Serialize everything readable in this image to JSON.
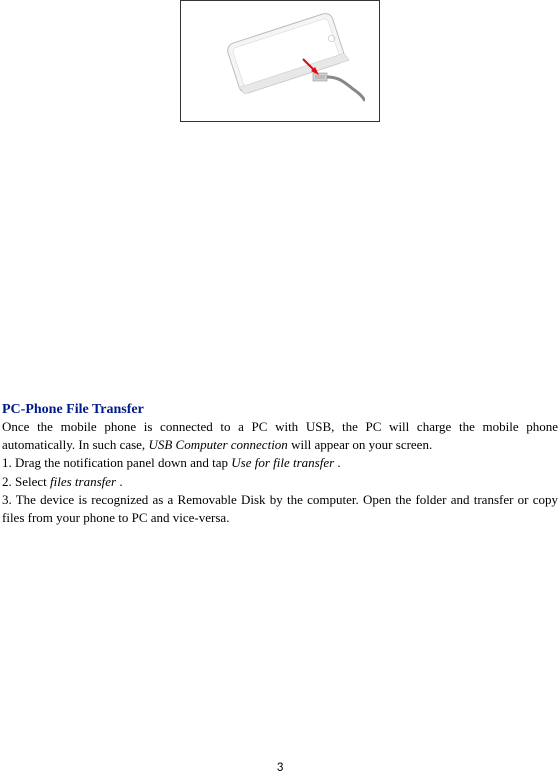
{
  "illustration": {
    "alt": "Phone connected via USB cable"
  },
  "section": {
    "heading": "PC-Phone File Transfer",
    "intro_part1": "Once the mobile phone is connected to a PC with USB, the PC will charge the mobile phone automatically. In such case, ",
    "intro_em": "USB Computer connection",
    "intro_part2": " will appear on your screen.",
    "step1_prefix": "1. Drag the notification panel down and tap ",
    "step1_em": "Use for file transfer",
    "step1_suffix": " .",
    "step2_prefix": "2. Select ",
    "step2_em": "files transfer",
    "step2_suffix": " .",
    "step3": "3. The device is recognized as a Removable Disk by the computer. Open the folder and transfer or copy files from your phone to PC and vice-versa."
  },
  "page_number": "3"
}
